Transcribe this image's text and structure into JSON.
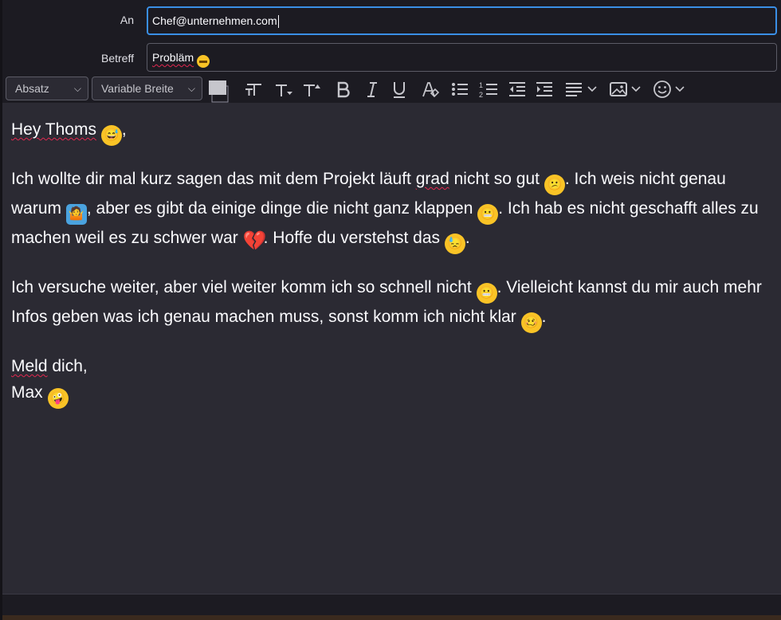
{
  "header": {
    "to_label": "An",
    "to_value": "Chef@unternehmen.com",
    "subject_label": "Betreff",
    "subject_value": "Probläm",
    "subject_emoji": "grimacing"
  },
  "toolbar": {
    "paragraph_format": "Absatz",
    "font": "Variable Breite",
    "buttons": [
      "text-color",
      "font-size-smaller",
      "font-size-larger",
      "bold",
      "italic",
      "underline",
      "remove-formatting",
      "bullet-list",
      "numbered-list",
      "outdent",
      "indent",
      "alignment",
      "insert-image",
      "insert-emoji"
    ]
  },
  "body": {
    "greeting": "Hey Thoms",
    "greeting_emoji": "grinning-sweat",
    "greeting_comma": ",",
    "p1": {
      "a": "Ich wollte dir mal kurz sagen das mit dem Projekt läuft",
      "b": "grad",
      "c": "nicht so gut",
      "d": ". Ich weis nicht genau warum",
      "e": ", aber es gibt da einige dinge die nicht ganz klappen",
      "f": ". Ich hab es nicht geschafft alles zu machen weil es zu schwer war",
      "g": ". Hoffe du verstehst das",
      "h": "."
    },
    "p2": {
      "a": "Ich versuche weiter, aber viel weiter komm ich so schnell nicht",
      "b": ". Vielleicht kannst du mir auch mehr Infos geben was ich genau machen muss, sonst komm ich nicht klar",
      "c": "."
    },
    "closing": {
      "word": "Meld",
      "rest": " dich,",
      "name": "Max"
    },
    "emojis": {
      "confused": "😕",
      "shrug": "🤷",
      "grimacing": "😬",
      "broken_heart": "💔",
      "downcast_sweat": "😓",
      "woozy": "🥴",
      "zany": "🤪",
      "grinning_sweat": "😅"
    }
  },
  "colors": {
    "background": "#1c1b22",
    "editor": "#2b2a33",
    "focus": "#3a8fe6",
    "spellcheck": "#e22850"
  }
}
